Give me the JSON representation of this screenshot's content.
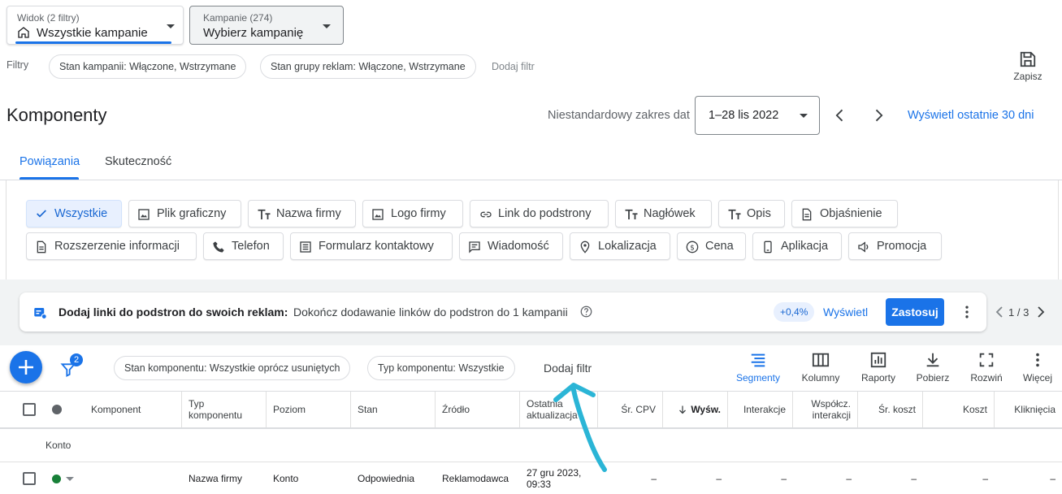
{
  "view": {
    "label": "Widok (2 filtry)",
    "value": "Wszystkie kampanie"
  },
  "campaigns": {
    "label": "Kampanie (274)",
    "value": "Wybierz kampanię"
  },
  "filters": {
    "label": "Filtry",
    "chips": [
      "Stan kampanii: Włączone, Wstrzymane",
      "Stan grupy reklam: Włączone, Wstrzymane"
    ],
    "add": "Dodaj filtr"
  },
  "save_label": "Zapisz",
  "page_title": "Komponenty",
  "date": {
    "label": "Niestandardowy zakres dat",
    "value": "1–28 lis 2022",
    "last30": "Wyświetl ostatnie 30 dni"
  },
  "tabs": [
    "Powiązania",
    "Skuteczność"
  ],
  "type_buttons": {
    "row1": [
      "Wszystkie",
      "Plik graficzny",
      "Nazwa firmy",
      "Logo firmy",
      "Link do podstrony",
      "Nagłówek",
      "Opis",
      "Objaśnienie"
    ],
    "row2": [
      "Rozszerzenie informacji",
      "Telefon",
      "Formularz kontaktowy",
      "Wiadomość",
      "Lokalizacja",
      "Cena",
      "Aplikacja",
      "Promocja"
    ]
  },
  "recommendation": {
    "title": "Dodaj linki do podstron do swoich reklam:",
    "text": "Dokończ dodawanie linków do podstron do 1 kampanii",
    "badge": "+0,4%",
    "view": "Wyświetl",
    "apply": "Zastosuj",
    "pager": "1 / 3"
  },
  "toolbar": {
    "filter_count": "2",
    "chips": [
      "Stan komponentu: Wszystkie oprócz usuniętych",
      "Typ komponentu: Wszystkie"
    ],
    "add_filter": "Dodaj filtr",
    "tools": [
      "Segmenty",
      "Kolumny",
      "Raporty",
      "Pobierz",
      "Rozwiń",
      "Więcej"
    ]
  },
  "table": {
    "headers": [
      "Komponent",
      "Typ komponentu",
      "Poziom",
      "Stan",
      "Źródło",
      "Ostatnia aktualizacja",
      "Śr. CPV",
      "Wyśw.",
      "Interakcje",
      "Współcz. interakcji",
      "Śr. koszt",
      "Koszt",
      "Kliknięcia"
    ],
    "group": "Konto",
    "row": [
      "Nazwa firmy",
      "Konto",
      "Odpowiednia",
      "Reklamodawca",
      "27 gru 2023, 09:33",
      "–",
      "–",
      "–",
      "–",
      "–",
      "–",
      "–"
    ]
  },
  "colors": {
    "accent": "#1a73e8",
    "arrow": "#2bb5d6",
    "status_green": "#188038"
  }
}
